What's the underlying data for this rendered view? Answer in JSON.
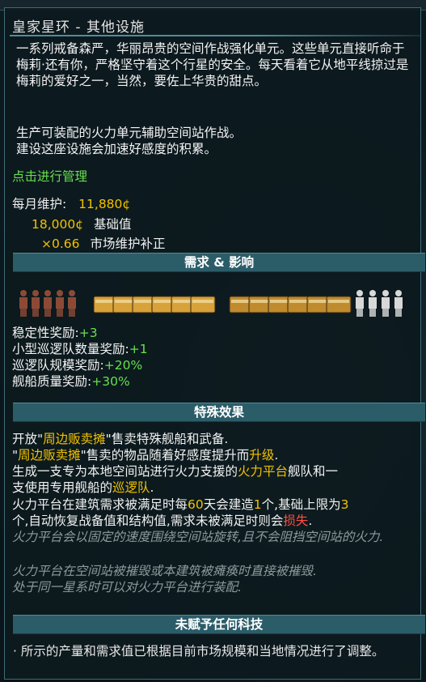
{
  "tooltip": {
    "title": "皇家星环 - 其他设施",
    "description": "一系列戒备森严，华丽昂贵的空间作战强化单元。这些单元直接听命于梅莉·还有你，严格坚守着这个行星的安全。每天看着它从地平线掠过是梅莉的爱好之一，当然，要佐上华贵的甜点。",
    "production": "生产可装配的火力单元辅助空间站作战。",
    "construction": "建设这座设施会加速好感度的积累。",
    "manage_link": "点击进行管理",
    "upkeep": {
      "label": "每月维护:",
      "value": "11,880¢",
      "base_value": "18,000¢",
      "base_label": "基础值",
      "multiplier": "×0.66",
      "multiplier_label": "市场维护补正"
    },
    "demand_header": "需求 & 影响",
    "demand_icons": [
      {
        "name": "marines",
        "count": 5,
        "color": "#8c4a36"
      },
      {
        "name": "supplies",
        "count": 6,
        "color": "#d8a23a"
      },
      {
        "name": "heavy-armaments",
        "count": 6,
        "color": "#bf8b2e"
      },
      {
        "name": "crew",
        "count": 4,
        "color": "#d8d8d8"
      }
    ],
    "bonuses": [
      {
        "label": "稳定性奖励:",
        "value": "+3"
      },
      {
        "label": "小型巡逻队数量奖励:",
        "value": "+1"
      },
      {
        "label": "巡逻队规模奖励:",
        "value": "+20%"
      },
      {
        "label": "舰船质量奖励:",
        "value": "+30%"
      }
    ],
    "special_header": "特殊效果",
    "special": {
      "l1_a": "开放",
      "l1_q1": "\"",
      "l1_link": "周边贩卖摊",
      "l1_q2": "\"",
      "l1_b": "售卖特殊舰船和武备.",
      "l2_q1": "\"",
      "l2_link": "周边贩卖摊",
      "l2_q2": "\"",
      "l2_b": "售卖的物品随着好感度提升而",
      "l2_hl": "升级",
      "l2_end": ".",
      "l3_a": "生成一支专为本地空间站进行火力支援的",
      "l3_hl": "火力平台",
      "l3_b": "舰队和一",
      "l4_a": "支使用专用舰船的",
      "l4_hl": "巡逻队",
      "l4_end": ".",
      "l5_a": "火力平台在建筑需求被满足时每",
      "l5_n1": "60",
      "l5_b": "天会建造",
      "l5_n2": "1",
      "l5_c": "个,基础上限为",
      "l5_n3": "3",
      "l6_a": "个,自动恢复战备值和结构值,需求未被满足时则会",
      "l6_hl": "损失",
      "l6_end": ".",
      "note1": "火力平台会以固定的速度围绕空间站旋转,且不会阻挡空间站的火力.",
      "note2": "火力平台在空间站被摧毁或本建筑被瘫痪时直接被摧毁.",
      "note3": "处于同一星系时可以对火力平台进行装配."
    },
    "tech_header": "未赋予任何科技",
    "footnote": "· 所示的产量和需求值已根据目前市场规模和当地情况进行了调整。"
  }
}
